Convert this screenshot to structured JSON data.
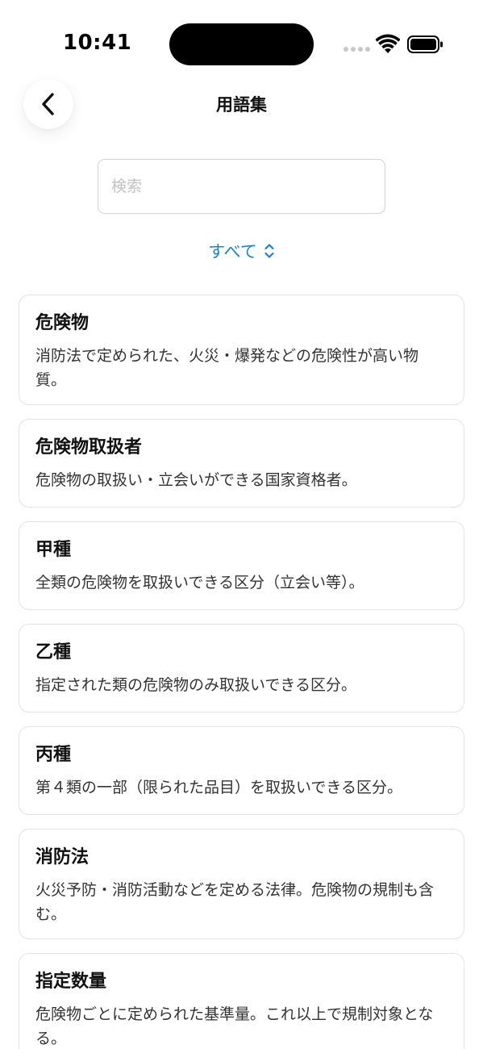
{
  "status_bar": {
    "time": "10:41",
    "icons": [
      "signal-dots-icon",
      "wifi-icon",
      "battery-icon"
    ]
  },
  "nav": {
    "back_icon": "chevron-left-icon",
    "title": "用語集"
  },
  "search": {
    "placeholder": "検索",
    "value": ""
  },
  "filter": {
    "label": "すべて",
    "icon": "chevron-up-down-icon"
  },
  "colors": {
    "accent": "#1a82d9",
    "card_border": "#e3e3e3",
    "text": "#111111",
    "subtext": "#333333"
  },
  "terms": [
    {
      "term": "危険物",
      "description": "消防法で定められた、火災・爆発などの危険性が高い物質。"
    },
    {
      "term": "危険物取扱者",
      "description": "危険物の取扱い・立会いができる国家資格者。"
    },
    {
      "term": "甲種",
      "description": "全類の危険物を取扱いできる区分（立会い等）。"
    },
    {
      "term": "乙種",
      "description": "指定された類の危険物のみ取扱いできる区分。"
    },
    {
      "term": "丙種",
      "description": "第４類の一部（限られた品目）を取扱いできる区分。"
    },
    {
      "term": "消防法",
      "description": "火災予防・消防活動などを定める法律。危険物の規制も含む。"
    },
    {
      "term": "指定数量",
      "description": "危険物ごとに定められた基準量。これ以上で規制対象となる。"
    }
  ]
}
